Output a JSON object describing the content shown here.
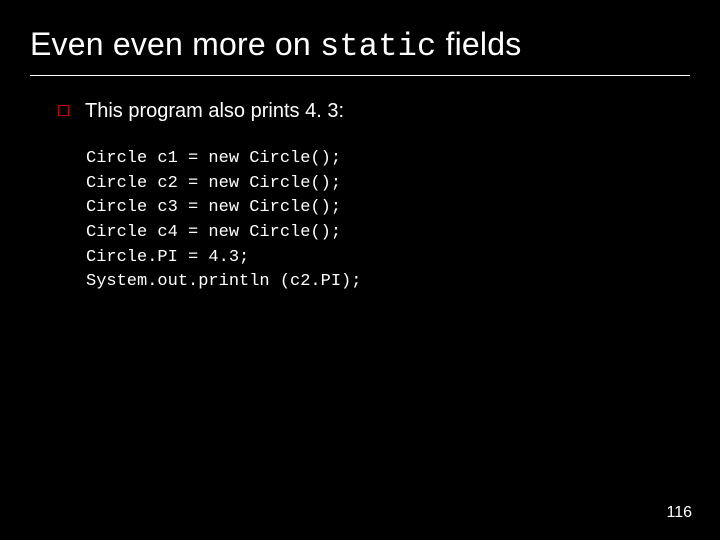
{
  "slide": {
    "title_pre": "Even even more on ",
    "title_mono": "static",
    "title_post": " fields",
    "bullet": "This program also prints 4. 3:",
    "code": "Circle c1 = new Circle();\nCircle c2 = new Circle();\nCircle c3 = new Circle();\nCircle c4 = new Circle();\nCircle.PI = 4.3;\nSystem.out.println (c2.PI);",
    "page_number": "116"
  }
}
